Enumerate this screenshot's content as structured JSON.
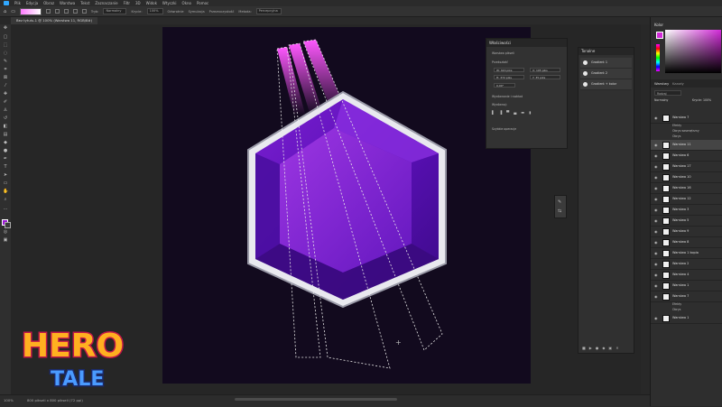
{
  "menu": [
    "Plik",
    "Edycja",
    "Obraz",
    "Warstwa",
    "Tekst",
    "Zaznaczanie",
    "Filtr",
    "3D",
    "Widok",
    "Wtyczki",
    "Okno",
    "Pomoc"
  ],
  "options": {
    "mode_label": "Tryb:",
    "mode_value": "Normalny",
    "opacity_label": "Krycie:",
    "opacity_value": "100%",
    "reverse": "Odwrotnie",
    "dither": "Symulacja",
    "transparency": "Przezroczystość",
    "method_label": "Metoda:",
    "method_value": "Percepcyjna"
  },
  "document_tab": "Bez tytułu-1 @ 100% (Warstwa 11, RGB/8#)",
  "status": {
    "zoom": "100%",
    "size": "800 pikseli x 800 pikseli (72 ppi)"
  },
  "properties_panel": {
    "title": "Właściwości",
    "layer_type": "Warstwa pikseli",
    "transform_label": "Przekształć",
    "w": "W: 420 piks",
    "x": "X: 195 piks",
    "h": "H: 372 piks",
    "y": "Y: 35 piks",
    "angle": "0,00°",
    "align_label": "Wyrównanie i rozkład",
    "align_sub": "Wyrównaj:",
    "quick_actions": "Szybkie operacje"
  },
  "actions_panel": {
    "title": "Tonalne",
    "items": [
      "Gradient 1",
      "Gradient 2",
      "Gradient + kolor"
    ]
  },
  "color_panel": {
    "title": "Kolor",
    "hue": "#d22bd8"
  },
  "layers_panel": {
    "tabs": [
      "Warstwy",
      "Kanały"
    ],
    "search_placeholder": "Rodzaj",
    "blend": "Normalny",
    "opacity": "Krycie: 100%",
    "rows": [
      {
        "name": "Warstwa 7",
        "fx": [
          "Efekty",
          "Obrys wewnętrzny",
          "Obrys"
        ]
      },
      {
        "name": "Warstwa 11"
      },
      {
        "name": "Warstwa 6"
      },
      {
        "name": "Warstwa 17"
      },
      {
        "name": "Warstwa 10"
      },
      {
        "name": "Warstwa 16"
      },
      {
        "name": "Warstwa 12"
      },
      {
        "name": "Warstwa 3"
      },
      {
        "name": "Warstwa 5"
      },
      {
        "name": "Warstwa 9"
      },
      {
        "name": "Warstwa 8"
      },
      {
        "name": "Warstwa 1 kopia"
      },
      {
        "name": "Warstwa 2"
      },
      {
        "name": "Warstwa 4"
      },
      {
        "name": "Warstwa 1"
      },
      {
        "name": "Warstwa 7",
        "fx": [
          "Efekty",
          "Obrys"
        ]
      },
      {
        "name": "Warstwa 1"
      }
    ]
  },
  "logo": {
    "line1": "HERO",
    "line2": "TALE"
  },
  "colors": {
    "accent": "#9b19d4",
    "artboard": "#120a1e"
  }
}
